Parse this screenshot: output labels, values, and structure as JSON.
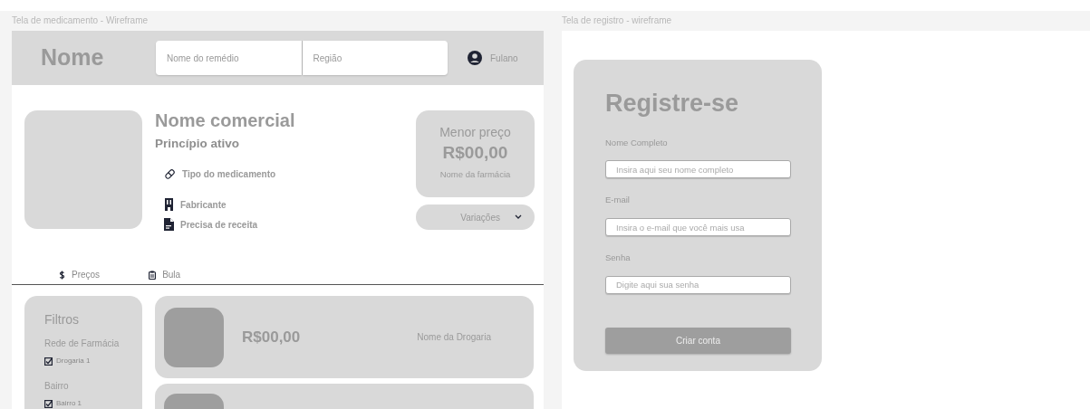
{
  "medication_frame": {
    "title": "Tela de medicamento - Wireframe",
    "header": {
      "logo": "Nome",
      "search": {
        "placeholder": "Nome do remédio"
      },
      "region": {
        "placeholder": "Região"
      },
      "user": "Fulano"
    },
    "product": {
      "name": "Nome comercial",
      "active_ingredient": "Princípio ativo",
      "details": [
        {
          "kind": "type",
          "text": "Tipo do medicamento"
        },
        {
          "kind": "manufacturer",
          "text": "Fabricante"
        },
        {
          "kind": "prescription",
          "text": "Precisa de receita"
        }
      ],
      "best_price": {
        "label": "Menor preço",
        "price": "R$00,00",
        "pharmacy": "Nome da farmácia"
      },
      "variations": "Variações"
    },
    "tabs": [
      {
        "kind": "prices",
        "label": "Preços"
      },
      {
        "kind": "leaflet",
        "label": "Bula"
      }
    ],
    "filters": {
      "title": "Filtros",
      "groups": [
        {
          "title": "Rede de Farmácia",
          "options": [
            {
              "label": "Drogaria 1",
              "checked": true
            }
          ]
        },
        {
          "title": "Bairro",
          "options": [
            {
              "label": "Bairro 1",
              "checked": true
            }
          ]
        }
      ]
    },
    "offers": [
      {
        "kind": "offer",
        "price": "R$00,00",
        "pharmacy": "Nome da Drogaria"
      },
      {
        "kind": "cut_off"
      }
    ]
  },
  "registration_frame": {
    "title": "Tela de registro - wireframe",
    "heading": "Registre-se",
    "fields": [
      {
        "label": "Nome Completo",
        "placeholder": "Insira aqui seu nome completo"
      },
      {
        "label": "E-mail",
        "placeholder": "Insira o e-mail que você mais usa"
      },
      {
        "label": "Senha",
        "placeholder": "Digite aqui sua senha"
      }
    ],
    "button": "Criar conta"
  }
}
